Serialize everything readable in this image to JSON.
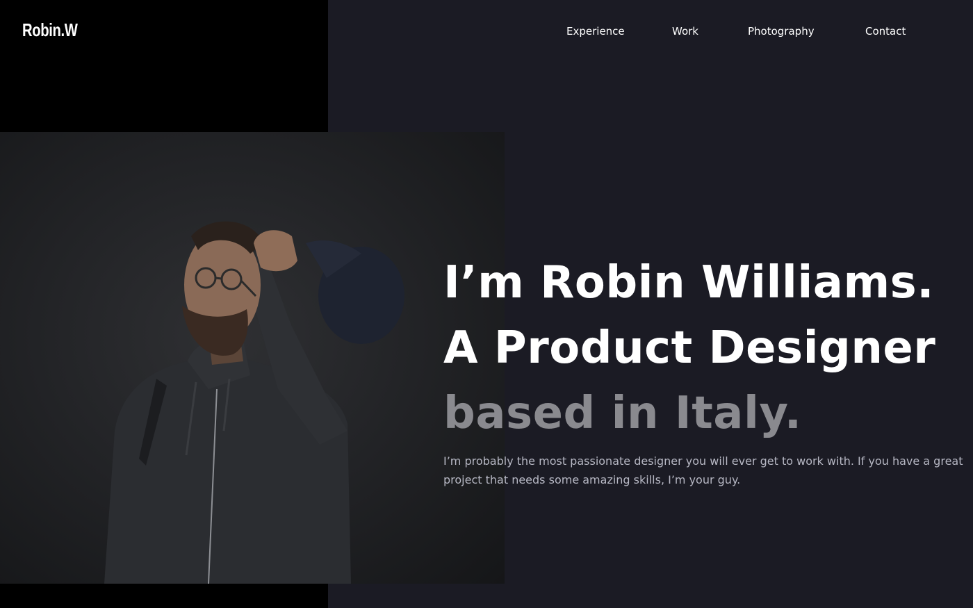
{
  "brand": {
    "logo_text": "Robin.W"
  },
  "nav": {
    "items": [
      {
        "label": "Experience"
      },
      {
        "label": "Work"
      },
      {
        "label": "Photography"
      },
      {
        "label": "Contact"
      }
    ]
  },
  "hero": {
    "line1": "I’m Robin Williams.",
    "line2": "A Product Designer",
    "line3": "based in Italy.",
    "intro": "I’m probably the most passionate designer you will ever get to work with. If you have a great project that needs some amazing skills, I’m your guy."
  },
  "colors": {
    "background": "#1b1b24",
    "left_panel": "#000000",
    "text_primary": "#ffffff",
    "text_muted": "#8a8a8f",
    "text_body": "#b7b8c4"
  }
}
